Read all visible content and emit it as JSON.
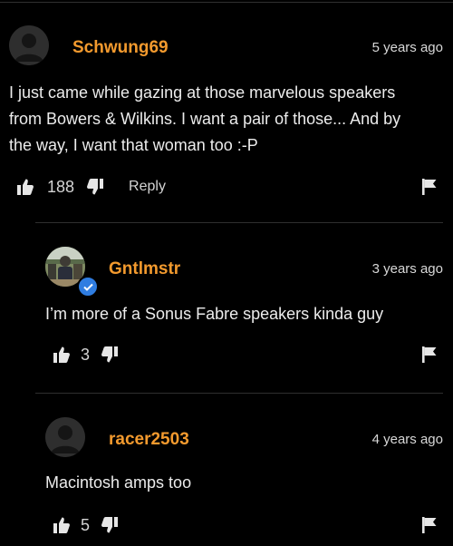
{
  "top_divider_visible": true,
  "comments": [
    {
      "username": "Schwung69",
      "timestamp": "5 years ago",
      "text_lines": [
        "I just came while gazing at those marvelous speakers",
        "from Bowers & Wilkins. I want a pair of those... And by",
        "the way, I want that woman too :-P"
      ],
      "likes": "188",
      "reply_label": "Reply",
      "avatar_icon": "default-user-icon",
      "verified": false
    },
    {
      "username": "Gntlmstr",
      "timestamp": "3 years ago",
      "text": "I’m more of a Sonus Fabre speakers kinda guy",
      "likes": "3",
      "avatar_icon": "photo-avatar",
      "verified": true
    },
    {
      "username": "racer2503",
      "timestamp": "4 years ago",
      "text": "Macintosh amps too",
      "likes": "5",
      "avatar_icon": "default-user-icon",
      "verified": false
    }
  ],
  "colors": {
    "background": "#000000",
    "username": "#f39a2e",
    "text": "#ececec",
    "divider": "#2f2f2f",
    "verified_badge": "#2f7de1"
  }
}
